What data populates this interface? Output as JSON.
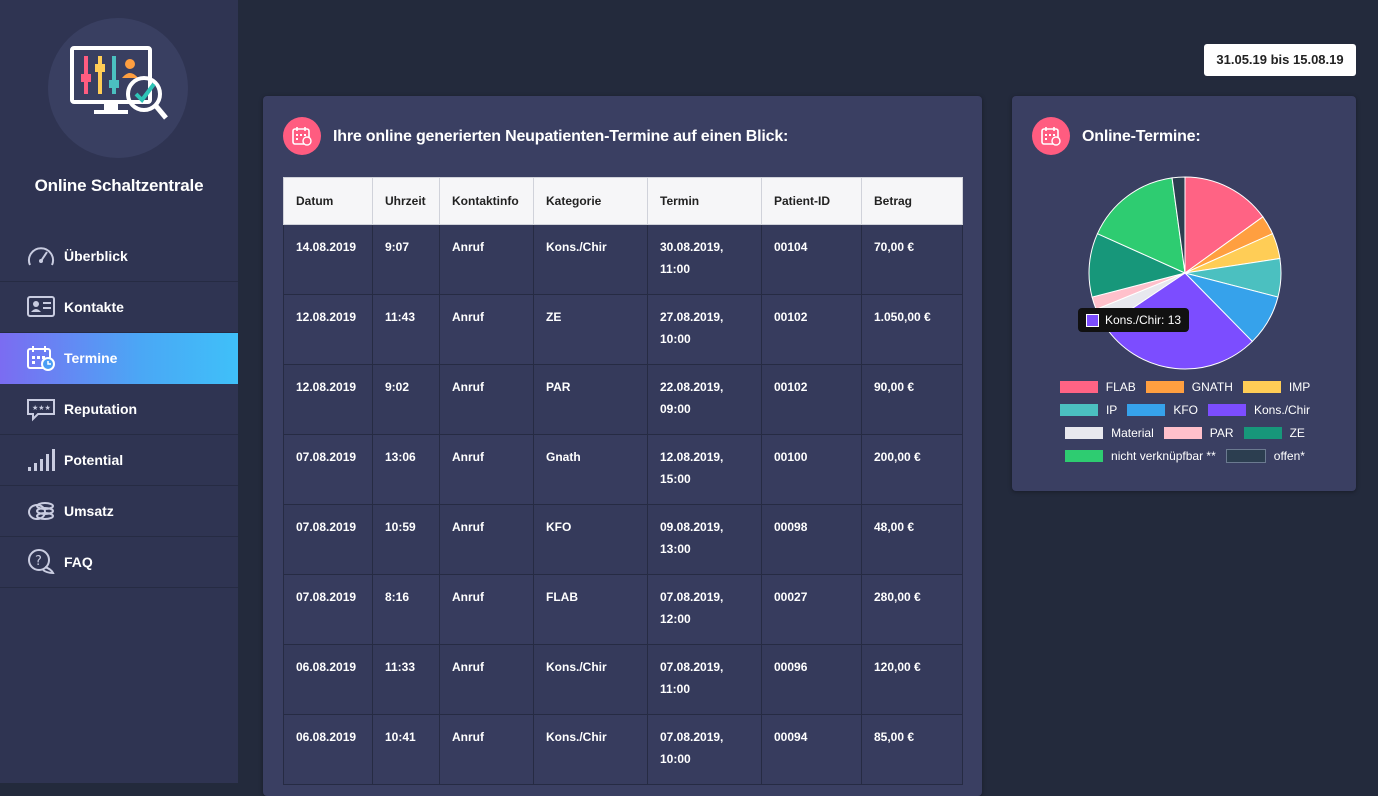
{
  "app": {
    "title": "Online Schaltzentrale"
  },
  "nav": [
    {
      "label": "Überblick",
      "icon": "speedometer-icon",
      "active": false
    },
    {
      "label": "Kontakte",
      "icon": "contact-card-icon",
      "active": false
    },
    {
      "label": "Termine",
      "icon": "calendar-icon",
      "active": true
    },
    {
      "label": "Reputation",
      "icon": "review-stars-icon",
      "active": false
    },
    {
      "label": "Potential",
      "icon": "signal-bars-icon",
      "active": false
    },
    {
      "label": "Umsatz",
      "icon": "coins-icon",
      "active": false
    },
    {
      "label": "FAQ",
      "icon": "question-bubble-icon",
      "active": false
    }
  ],
  "date_range": "31.05.19 bis 15.08.19",
  "main_panel": {
    "title": "Ihre online generierten Neupatienten-Termine auf einen Blick:",
    "columns": [
      "Datum",
      "Uhrzeit",
      "Kontaktinfo",
      "Kategorie",
      "Termin",
      "Patient-ID",
      "Betrag"
    ],
    "rows": [
      [
        "14.08.2019",
        "9:07",
        "Anruf",
        "Kons./Chir",
        "30.08.2019,",
        "11:00",
        "00104",
        "70,00 €"
      ],
      [
        "12.08.2019",
        "11:43",
        "Anruf",
        "ZE",
        "27.08.2019,",
        "10:00",
        "00102",
        "1.050,00 €"
      ],
      [
        "12.08.2019",
        "9:02",
        "Anruf",
        "PAR",
        "22.08.2019,",
        "09:00",
        "00102",
        "90,00 €"
      ],
      [
        "07.08.2019",
        "13:06",
        "Anruf",
        "Gnath",
        "12.08.2019,",
        "15:00",
        "00100",
        "200,00 €"
      ],
      [
        "07.08.2019",
        "10:59",
        "Anruf",
        "KFO",
        "09.08.2019,",
        "13:00",
        "00098",
        "48,00 €"
      ],
      [
        "07.08.2019",
        "8:16",
        "Anruf",
        "FLAB",
        "07.08.2019,",
        "12:00",
        "00027",
        "280,00 €"
      ],
      [
        "06.08.2019",
        "11:33",
        "Anruf",
        "Kons./Chir",
        "07.08.2019,",
        "11:00",
        "00096",
        "120,00 €"
      ],
      [
        "06.08.2019",
        "10:41",
        "Anruf",
        "Kons./Chir",
        "07.08.2019,",
        "10:00",
        "00094",
        "85,00 €"
      ]
    ]
  },
  "side_panel": {
    "title": "Online-Termine:",
    "tooltip": "Kons./Chir: 13"
  },
  "chart_data": {
    "type": "pie",
    "slices": [
      {
        "label": "FLAB",
        "value": 7,
        "color": "#ff6384"
      },
      {
        "label": "GNATH",
        "value": 1.5,
        "color": "#ff9f40"
      },
      {
        "label": "IMP",
        "value": 2,
        "color": "#ffcd56"
      },
      {
        "label": "IP",
        "value": 3,
        "color": "#4bc0c0"
      },
      {
        "label": "KFO",
        "value": 4,
        "color": "#36a2eb"
      },
      {
        "label": "Kons./Chir",
        "value": 13,
        "color": "#7c4dff"
      },
      {
        "label": "Material",
        "value": 1.5,
        "color": "#e8e8ee"
      },
      {
        "label": "PAR",
        "value": 1,
        "color": "#ffc0cb"
      },
      {
        "label": "ZE",
        "value": 5,
        "color": "#17977a"
      },
      {
        "label": "nicht verknüpfbar **",
        "value": 7.5,
        "color": "#2ecc71"
      },
      {
        "label": "offen*",
        "value": 1,
        "color": "#2c3e50"
      }
    ],
    "legend_position": "bottom"
  }
}
